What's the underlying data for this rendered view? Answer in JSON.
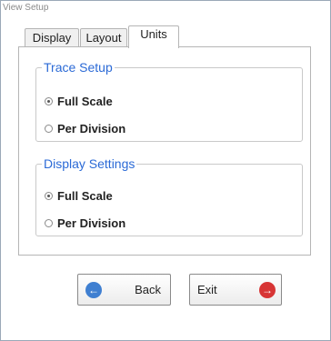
{
  "window": {
    "title": "View Setup"
  },
  "tabs": [
    {
      "label": "Display",
      "active": false
    },
    {
      "label": "Layout",
      "active": false
    },
    {
      "label": "Units",
      "active": true
    }
  ],
  "trace_setup": {
    "legend": "Trace Setup",
    "options": [
      {
        "label": "Full Scale",
        "selected": true
      },
      {
        "label": "Per Division",
        "selected": false
      }
    ]
  },
  "display_settings": {
    "legend": "Display Settings",
    "options": [
      {
        "label": "Full Scale",
        "selected": true
      },
      {
        "label": "Per Division",
        "selected": false
      }
    ]
  },
  "buttons": {
    "back_label": "Back",
    "exit_label": "Exit",
    "back_icon": "back-arrow-icon",
    "exit_icon": "exit-arrow-icon",
    "back_icon_color": "#3f7fd1",
    "exit_icon_color": "#d73535"
  },
  "colors": {
    "legend": "#2b6ad6"
  }
}
